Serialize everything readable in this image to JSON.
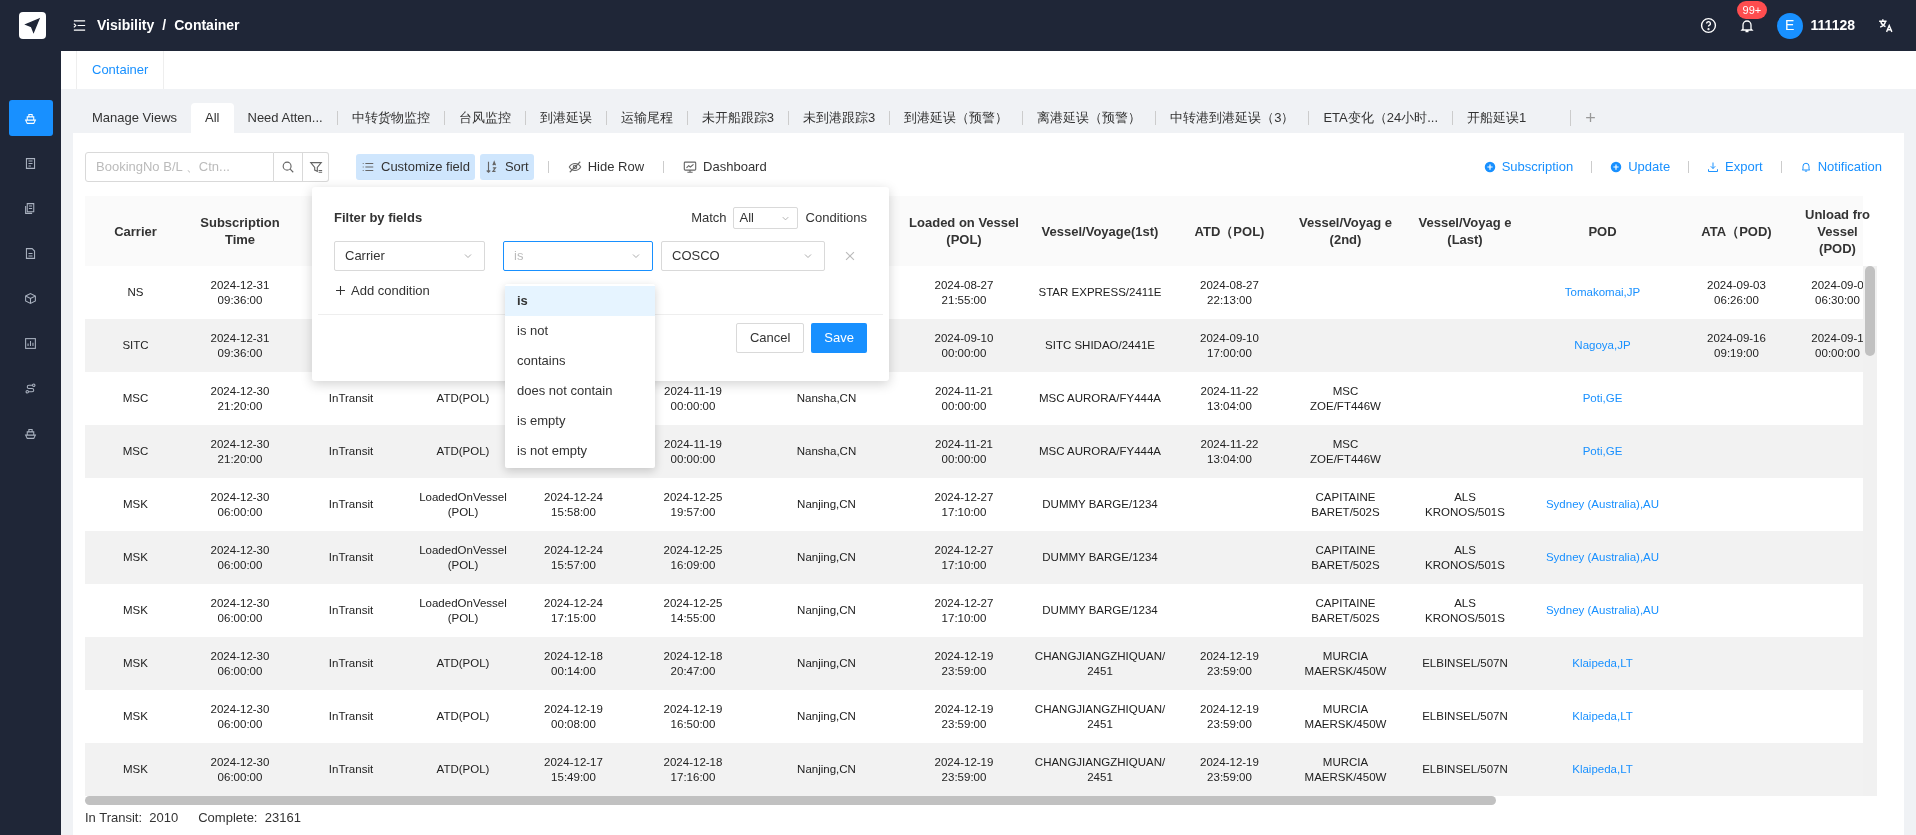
{
  "topbar": {
    "breadcrumb": [
      "Visibility",
      "Container"
    ],
    "separator": "/",
    "notification_badge": "99+",
    "avatar_letter": "E",
    "user": "111128"
  },
  "sidebar": {
    "items": [
      {
        "selected": true
      },
      {
        "selected": false
      },
      {
        "selected": false
      },
      {
        "selected": false
      },
      {
        "selected": false
      },
      {
        "selected": false
      },
      {
        "selected": false
      },
      {
        "selected": false
      }
    ]
  },
  "page_tabs": [
    {
      "label": "Container",
      "selected": true
    }
  ],
  "view_tabs": [
    {
      "label": "Manage Views",
      "kind": "manage",
      "selected": false
    },
    {
      "label": "All",
      "kind": "view",
      "selected": true
    },
    {
      "label": "Need Atten...",
      "kind": "view",
      "selected": false
    },
    {
      "label": "中转货物监控",
      "kind": "view",
      "selected": false
    },
    {
      "label": "台风监控",
      "kind": "view",
      "selected": false
    },
    {
      "label": "到港延误",
      "kind": "view",
      "selected": false
    },
    {
      "label": "运输尾程",
      "kind": "view",
      "selected": false
    },
    {
      "label": "未开船跟踪3",
      "kind": "view",
      "selected": false
    },
    {
      "label": "未到港跟踪3",
      "kind": "view",
      "selected": false
    },
    {
      "label": "到港延误（预警）",
      "kind": "view",
      "selected": false
    },
    {
      "label": "离港延误（预警）",
      "kind": "view",
      "selected": false
    },
    {
      "label": "中转港到港延误（3）",
      "kind": "view",
      "selected": false
    },
    {
      "label": "ETA变化（24小时...",
      "kind": "view",
      "selected": false
    },
    {
      "label": "开船延误1",
      "kind": "view",
      "selected": false
    }
  ],
  "add_view_tab": "+",
  "search": {
    "placeholder": "BookingNo B/L 、Ctn..."
  },
  "toolbar_left": [
    {
      "label": "Customize field",
      "kind": "list",
      "active": true
    },
    {
      "label": "Sort",
      "kind": "sort",
      "active": true
    },
    {
      "label": "Hide Row",
      "kind": "eye",
      "active": false
    },
    {
      "label": "Dashboard",
      "kind": "monitor",
      "active": false
    }
  ],
  "toolbar_right": [
    {
      "label": "Subscription",
      "kind": "plus"
    },
    {
      "label": "Update",
      "kind": "plus"
    },
    {
      "label": "Export",
      "kind": "download"
    },
    {
      "label": "Notification",
      "kind": "bell"
    }
  ],
  "table": {
    "columns": [
      {
        "header": "Carrier",
        "kind": "text"
      },
      {
        "header": "Subscription Time",
        "kind": "text"
      },
      null,
      null,
      null,
      null,
      null,
      {
        "header": "Loaded on Vessel (POL)",
        "kind": "text"
      },
      {
        "header": "Vessel/Voyage(1st)",
        "kind": "text"
      },
      {
        "header": "ATD（POL)",
        "kind": "text"
      },
      {
        "header": "Vessel/Voyag e (2nd)",
        "kind": "text"
      },
      {
        "header": "Vessel/Voyag e (Last)",
        "kind": "text"
      },
      {
        "header": "POD",
        "kind": "link"
      },
      {
        "header": "ATA（POD)",
        "kind": "text"
      },
      {
        "header": "Unload fro Vessel (POD)",
        "kind": "text"
      }
    ],
    "rows": [
      [
        "NS",
        "2024-12-31\n09:36:00",
        null,
        null,
        null,
        null,
        null,
        "2024-08-27\n21:55:00",
        "STAR EXPRESS/2411E",
        "2024-08-27\n22:13:00",
        null,
        null,
        "Tomakomai,JP",
        "2024-09-03\n06:26:00",
        "2024-09-0\n06:30:00"
      ],
      [
        "SITC",
        "2024-12-31\n09:36:00",
        null,
        null,
        null,
        null,
        null,
        "2024-09-10\n00:00:00",
        "SITC SHIDAO/2441E",
        "2024-09-10\n17:00:00",
        null,
        null,
        "Nagoya,JP",
        "2024-09-16\n09:19:00",
        "2024-09-1\n00:00:00"
      ],
      [
        "MSC",
        "2024-12-30\n21:20:00",
        "InTransit",
        "ATD(POL)",
        null,
        "2024-11-19\n00:00:00",
        "Nansha,CN",
        "2024-11-21\n00:00:00",
        "MSC AURORA/FY444A",
        "2024-11-22\n13:04:00",
        "MSC\nZOE/FT446W",
        null,
        "Poti,GE",
        null,
        null
      ],
      [
        "MSC",
        "2024-12-30\n21:20:00",
        "InTransit",
        "ATD(POL)",
        null,
        "2024-11-19\n00:00:00",
        "Nansha,CN",
        "2024-11-21\n00:00:00",
        "MSC AURORA/FY444A",
        "2024-11-22\n13:04:00",
        "MSC\nZOE/FT446W",
        null,
        "Poti,GE",
        null,
        null
      ],
      [
        "MSK",
        "2024-12-30\n06:00:00",
        "InTransit",
        "LoadedOnVessel\n(POL)",
        "2024-12-24\n15:58:00",
        "2024-12-25\n19:57:00",
        "Nanjing,CN",
        "2024-12-27\n17:10:00",
        "DUMMY BARGE/1234",
        null,
        "CAPITAINE\nBARET/502S",
        "ALS\nKRONOS/501S",
        "Sydney (Australia),AU",
        null,
        null
      ],
      [
        "MSK",
        "2024-12-30\n06:00:00",
        "InTransit",
        "LoadedOnVessel\n(POL)",
        "2024-12-24\n15:57:00",
        "2024-12-25\n16:09:00",
        "Nanjing,CN",
        "2024-12-27\n17:10:00",
        "DUMMY BARGE/1234",
        null,
        "CAPITAINE\nBARET/502S",
        "ALS\nKRONOS/501S",
        "Sydney (Australia),AU",
        null,
        null
      ],
      [
        "MSK",
        "2024-12-30\n06:00:00",
        "InTransit",
        "LoadedOnVessel\n(POL)",
        "2024-12-24\n17:15:00",
        "2024-12-25\n14:55:00",
        "Nanjing,CN",
        "2024-12-27\n17:10:00",
        "DUMMY BARGE/1234",
        null,
        "CAPITAINE\nBARET/502S",
        "ALS\nKRONOS/501S",
        "Sydney (Australia),AU",
        null,
        null
      ],
      [
        "MSK",
        "2024-12-30\n06:00:00",
        "InTransit",
        "ATD(POL)",
        "2024-12-18\n00:14:00",
        "2024-12-18\n20:47:00",
        "Nanjing,CN",
        "2024-12-19\n23:59:00",
        "CHANGJIANGZHIQUAN/\n2451",
        "2024-12-19\n23:59:00",
        "MURCIA\nMAERSK/450W",
        "ELBINSEL/507N",
        "Klaipeda,LT",
        null,
        null
      ],
      [
        "MSK",
        "2024-12-30\n06:00:00",
        "InTransit",
        "ATD(POL)",
        "2024-12-19\n00:08:00",
        "2024-12-19\n16:50:00",
        "Nanjing,CN",
        "2024-12-19\n23:59:00",
        "CHANGJIANGZHIQUAN/\n2451",
        "2024-12-19\n23:59:00",
        "MURCIA\nMAERSK/450W",
        "ELBINSEL/507N",
        "Klaipeda,LT",
        null,
        null
      ],
      [
        "MSK",
        "2024-12-30\n06:00:00",
        "InTransit",
        "ATD(POL)",
        "2024-12-17\n15:49:00",
        "2024-12-18\n17:16:00",
        "Nanjing,CN",
        "2024-12-19\n23:59:00",
        "CHANGJIANGZHIQUAN/\n2451",
        "2024-12-19\n23:59:00",
        "MURCIA\nMAERSK/450W",
        "ELBINSEL/507N",
        "Klaipeda,LT",
        null,
        null
      ]
    ]
  },
  "footer": [
    {
      "label": "In Transit:",
      "value": "2010"
    },
    {
      "label": "Complete:",
      "value": "23161"
    }
  ],
  "filter_popover": {
    "title": "Filter by fields",
    "match_label": "Match",
    "match_value": "All",
    "conditions_label": "Conditions",
    "condition": {
      "field": "Carrier",
      "operator_placeholder": "is",
      "value": "COSCO"
    },
    "add_condition": "Add condition",
    "buttons": [
      {
        "label": "Cancel",
        "kind": "default"
      },
      {
        "label": "Save",
        "kind": "primary"
      }
    ],
    "operator_options": [
      {
        "label": "is",
        "selected": true
      },
      {
        "label": "is not",
        "selected": false
      },
      {
        "label": "contains",
        "selected": false
      },
      {
        "label": "does not contain",
        "selected": false
      },
      {
        "label": "is empty",
        "selected": false
      },
      {
        "label": "is not empty",
        "selected": false
      }
    ]
  }
}
